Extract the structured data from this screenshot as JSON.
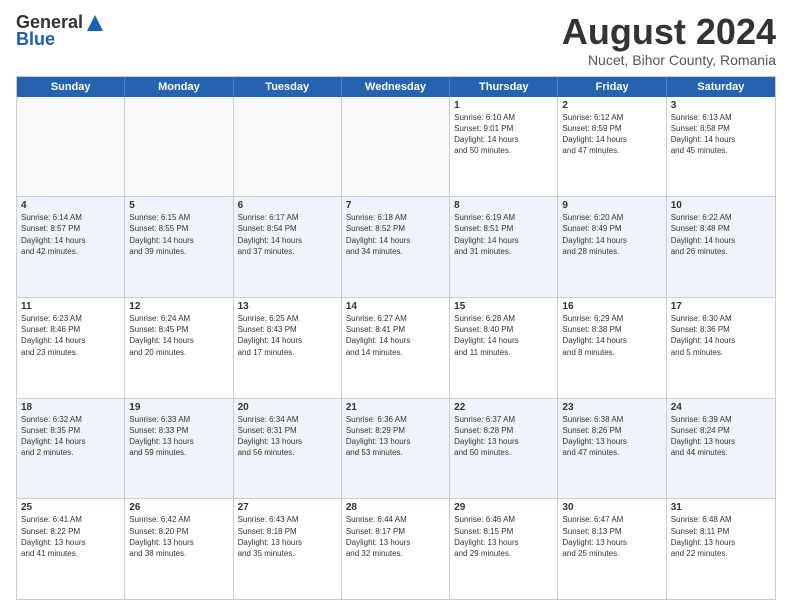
{
  "header": {
    "logo_general": "General",
    "logo_blue": "Blue",
    "month_title": "August 2024",
    "location": "Nucet, Bihor County, Romania"
  },
  "days_of_week": [
    "Sunday",
    "Monday",
    "Tuesday",
    "Wednesday",
    "Thursday",
    "Friday",
    "Saturday"
  ],
  "weeks": [
    [
      {
        "day": "",
        "text": "",
        "empty": true
      },
      {
        "day": "",
        "text": "",
        "empty": true
      },
      {
        "day": "",
        "text": "",
        "empty": true
      },
      {
        "day": "",
        "text": "",
        "empty": true
      },
      {
        "day": "1",
        "text": "Sunrise: 6:10 AM\nSunset: 9:01 PM\nDaylight: 14 hours\nand 50 minutes."
      },
      {
        "day": "2",
        "text": "Sunrise: 6:12 AM\nSunset: 8:59 PM\nDaylight: 14 hours\nand 47 minutes."
      },
      {
        "day": "3",
        "text": "Sunrise: 6:13 AM\nSunset: 8:58 PM\nDaylight: 14 hours\nand 45 minutes."
      }
    ],
    [
      {
        "day": "4",
        "text": "Sunrise: 6:14 AM\nSunset: 8:57 PM\nDaylight: 14 hours\nand 42 minutes."
      },
      {
        "day": "5",
        "text": "Sunrise: 6:15 AM\nSunset: 8:55 PM\nDaylight: 14 hours\nand 39 minutes."
      },
      {
        "day": "6",
        "text": "Sunrise: 6:17 AM\nSunset: 8:54 PM\nDaylight: 14 hours\nand 37 minutes."
      },
      {
        "day": "7",
        "text": "Sunrise: 6:18 AM\nSunset: 8:52 PM\nDaylight: 14 hours\nand 34 minutes."
      },
      {
        "day": "8",
        "text": "Sunrise: 6:19 AM\nSunset: 8:51 PM\nDaylight: 14 hours\nand 31 minutes."
      },
      {
        "day": "9",
        "text": "Sunrise: 6:20 AM\nSunset: 8:49 PM\nDaylight: 14 hours\nand 28 minutes."
      },
      {
        "day": "10",
        "text": "Sunrise: 6:22 AM\nSunset: 8:48 PM\nDaylight: 14 hours\nand 26 minutes."
      }
    ],
    [
      {
        "day": "11",
        "text": "Sunrise: 6:23 AM\nSunset: 8:46 PM\nDaylight: 14 hours\nand 23 minutes."
      },
      {
        "day": "12",
        "text": "Sunrise: 6:24 AM\nSunset: 8:45 PM\nDaylight: 14 hours\nand 20 minutes."
      },
      {
        "day": "13",
        "text": "Sunrise: 6:25 AM\nSunset: 8:43 PM\nDaylight: 14 hours\nand 17 minutes."
      },
      {
        "day": "14",
        "text": "Sunrise: 6:27 AM\nSunset: 8:41 PM\nDaylight: 14 hours\nand 14 minutes."
      },
      {
        "day": "15",
        "text": "Sunrise: 6:28 AM\nSunset: 8:40 PM\nDaylight: 14 hours\nand 11 minutes."
      },
      {
        "day": "16",
        "text": "Sunrise: 6:29 AM\nSunset: 8:38 PM\nDaylight: 14 hours\nand 8 minutes."
      },
      {
        "day": "17",
        "text": "Sunrise: 6:30 AM\nSunset: 8:36 PM\nDaylight: 14 hours\nand 5 minutes."
      }
    ],
    [
      {
        "day": "18",
        "text": "Sunrise: 6:32 AM\nSunset: 8:35 PM\nDaylight: 14 hours\nand 2 minutes."
      },
      {
        "day": "19",
        "text": "Sunrise: 6:33 AM\nSunset: 8:33 PM\nDaylight: 13 hours\nand 59 minutes."
      },
      {
        "day": "20",
        "text": "Sunrise: 6:34 AM\nSunset: 8:31 PM\nDaylight: 13 hours\nand 56 minutes."
      },
      {
        "day": "21",
        "text": "Sunrise: 6:36 AM\nSunset: 8:29 PM\nDaylight: 13 hours\nand 53 minutes."
      },
      {
        "day": "22",
        "text": "Sunrise: 6:37 AM\nSunset: 8:28 PM\nDaylight: 13 hours\nand 50 minutes."
      },
      {
        "day": "23",
        "text": "Sunrise: 6:38 AM\nSunset: 8:26 PM\nDaylight: 13 hours\nand 47 minutes."
      },
      {
        "day": "24",
        "text": "Sunrise: 6:39 AM\nSunset: 8:24 PM\nDaylight: 13 hours\nand 44 minutes."
      }
    ],
    [
      {
        "day": "25",
        "text": "Sunrise: 6:41 AM\nSunset: 8:22 PM\nDaylight: 13 hours\nand 41 minutes."
      },
      {
        "day": "26",
        "text": "Sunrise: 6:42 AM\nSunset: 8:20 PM\nDaylight: 13 hours\nand 38 minutes."
      },
      {
        "day": "27",
        "text": "Sunrise: 6:43 AM\nSunset: 8:18 PM\nDaylight: 13 hours\nand 35 minutes."
      },
      {
        "day": "28",
        "text": "Sunrise: 6:44 AM\nSunset: 8:17 PM\nDaylight: 13 hours\nand 32 minutes."
      },
      {
        "day": "29",
        "text": "Sunrise: 6:46 AM\nSunset: 8:15 PM\nDaylight: 13 hours\nand 29 minutes."
      },
      {
        "day": "30",
        "text": "Sunrise: 6:47 AM\nSunset: 8:13 PM\nDaylight: 13 hours\nand 25 minutes."
      },
      {
        "day": "31",
        "text": "Sunrise: 6:48 AM\nSunset: 8:11 PM\nDaylight: 13 hours\nand 22 minutes."
      }
    ]
  ]
}
